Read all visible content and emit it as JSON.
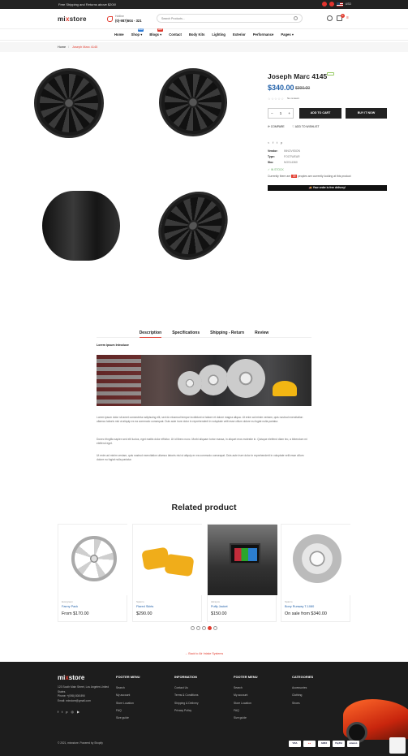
{
  "topbar": {
    "message": "Free Shipping and Returns above $200!",
    "wishlist_count": "0",
    "compare_count": "0",
    "currency": "USD"
  },
  "header": {
    "logo_prefix": "mi",
    "logo_x": "x",
    "logo_suffix": "store",
    "hotline_label": "Hotline",
    "hotline_phone": "(0)-987)604 - 321",
    "search_placeholder": "Search Products...",
    "cart_count": "0"
  },
  "nav": [
    {
      "label": "Home"
    },
    {
      "label": "Shop",
      "caret": true,
      "badge": "NEW",
      "badge_color": "#2d7bd6"
    },
    {
      "label": "Blogs",
      "caret": true,
      "badge": "HOT",
      "badge_color": "#e23c2f"
    },
    {
      "label": "Contact"
    },
    {
      "label": "Body Kits"
    },
    {
      "label": "Lighting"
    },
    {
      "label": "Exterior"
    },
    {
      "label": "Performance"
    },
    {
      "label": "Pages",
      "caret": true
    }
  ],
  "breadcrumb": {
    "home": "Home",
    "separator": "/",
    "current": "Joseph Marc 4145"
  },
  "product": {
    "title": "Joseph Marc 4145",
    "price": "$340.00",
    "compare_price": "$390.00",
    "stars": "☆☆☆☆☆",
    "reviews": "No reviews",
    "qty_minus": "−",
    "qty": "1",
    "qty_plus": "+",
    "add_to_cart": "ADD TO CART",
    "buy_now": "BUY IT NOW",
    "compare": "COMPARE",
    "wishlist": "ADD TO WISHLIST",
    "vendor_label": "Vendor:",
    "vendor": "INNOVISION",
    "type_label": "Type:",
    "type": "FOOTWEAR",
    "sku_label": "Sku:",
    "sku": "NOS14360",
    "stock": "IN STOCK",
    "viewers_before": "Currently there are",
    "viewers_count": "39",
    "viewers_after": "peoples are currently looking at this product",
    "shipping_bar": "Your order is free delivery!"
  },
  "tabs": [
    "Description",
    "Specifications",
    "Shipping - Return",
    "Review"
  ],
  "description": {
    "heading": "Lorem ipsum Introduce",
    "para1": "Lorem ipsum dolor sit amet consectetur adipiscing elit, sed do eiusmod tempor incididunt ut labore et dolore magna aliqua. Ut enim ad minim veniam, quis nostrud exercitation ullamco laboris nisi ut aliquip ex ea commodo consequat. Duis aute irure dolor in reprehenderit in voluptate velit esse cillum dolore eu fugiat nulla pariatur.",
    "para2": "Donec fringilla sapien sed elit luctus, eget mattis dolor efficitur. Ut id libero nunc. Morbi aliquam tortor massa, in aliquet eros molestie in. Quisque eleifend diam leo, a bibendum mi eleifend eget.",
    "para3": "Ut enim ad minim veniam, quis nostrud exercitation ullamco laboris nisi ut aliquip ex ea commodo consequat. Duis aute irure dolor in reprehenderit in voluptate velit esse cillum dolore eu fugiat nulla pariatur."
  },
  "related": {
    "title": "Related product",
    "items": [
      {
        "vendor": "Evergreen",
        "name": "Fanny Pack",
        "price": "From $170.00"
      },
      {
        "vendor": "Sparco",
        "name": "Flared Skirts",
        "price": "$290.00"
      },
      {
        "vendor": "Akrapov",
        "name": "Puffy Jacket",
        "price": "$150.00"
      },
      {
        "vendor": "Sparco",
        "name": "Bony Runway T-1080",
        "price": "On sale from $340.00"
      }
    ]
  },
  "back_link": "← Back to Air Intake Systems",
  "footer": {
    "address": "123 South Main Street, Los Angeles United States",
    "phone": "Phone: +(098) 808 890",
    "email": "Email: mixstore@gmail.com",
    "social": [
      "f",
      "t",
      "p",
      "◎",
      "▶"
    ],
    "col1": {
      "title": "FOOTER MENU",
      "links": [
        "Search",
        "My account",
        "Store Location",
        "FAQ",
        "Size guide"
      ]
    },
    "col2": {
      "title": "INFORMATION",
      "links": [
        "Contact Us",
        "Terms & Conditions",
        "Shipping & Delivery",
        "Privacy Policy"
      ]
    },
    "col3": {
      "title": "FOOTER MENU",
      "links": [
        "Search",
        "My account",
        "Store Location",
        "FAQ",
        "Size guide"
      ]
    },
    "col4": {
      "title": "CATEGORIES",
      "links": [
        "Accessories",
        "Clothing",
        "Shoes"
      ]
    },
    "copyright": "© 2021, mixxstore. Powered by Shopify",
    "payments": [
      "VISA",
      "●●",
      "AMEX",
      "PayPal",
      "amazon"
    ]
  }
}
